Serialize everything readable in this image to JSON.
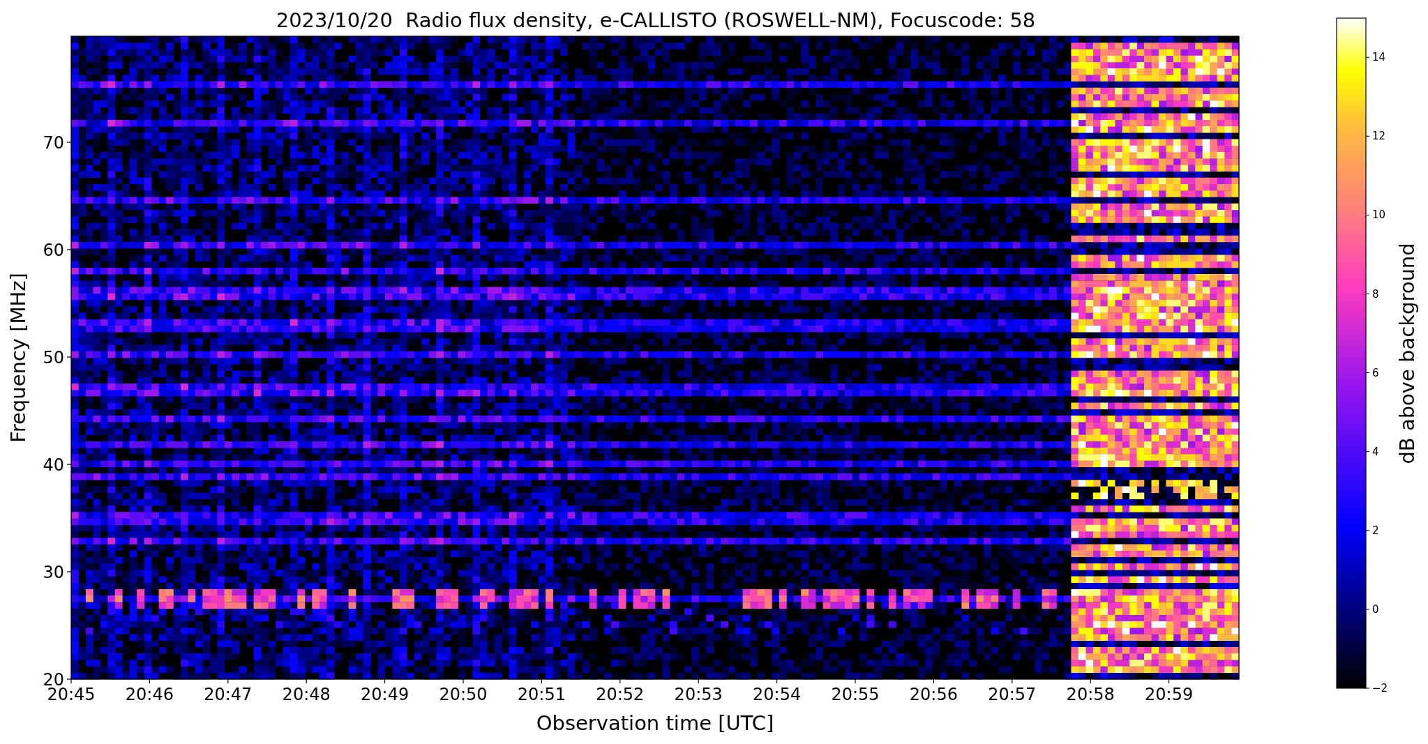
{
  "title": "2023/10/20  Radio flux density, e-CALLISTO (ROSWELL-NM), Focuscode: 58",
  "plot": {
    "ylabel": "Frequency [MHz]",
    "xlabel": "Observation time [UTC]",
    "xticks": [
      "20:45",
      "20:46",
      "20:47",
      "20:48",
      "20:49",
      "20:50",
      "20:51",
      "20:52",
      "20:53",
      "20:54",
      "20:55",
      "20:56",
      "20:57",
      "20:58",
      "20:59"
    ],
    "yticks": [
      "70",
      "60",
      "50",
      "40",
      "30",
      "20"
    ]
  },
  "colorbar": {
    "label": "dB above background",
    "ticks": [
      "14",
      "12",
      "10",
      "8",
      "6",
      "4",
      "2",
      "0",
      "−2"
    ]
  }
}
